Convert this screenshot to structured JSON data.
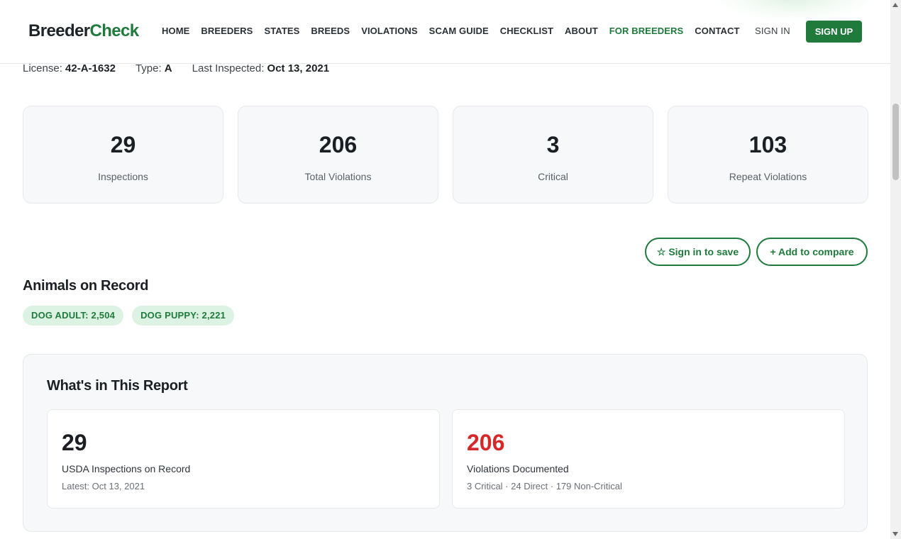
{
  "brand": {
    "part1": "Breeder",
    "part2": "Check",
    "accent_color": "#1f7a3c"
  },
  "nav": {
    "items": [
      {
        "label": "HOME"
      },
      {
        "label": "BREEDERS"
      },
      {
        "label": "STATES"
      },
      {
        "label": "BREEDS"
      },
      {
        "label": "VIOLATIONS"
      },
      {
        "label": "SCAM GUIDE"
      },
      {
        "label": "CHECKLIST"
      },
      {
        "label": "ABOUT"
      },
      {
        "label": "FOR BREEDERS",
        "highlight": true
      },
      {
        "label": "CONTACT"
      }
    ],
    "sign_in": "SIGN IN",
    "sign_up": "SIGN UP"
  },
  "meta": {
    "license_label": "License:",
    "license_value": "42-A-1632",
    "type_label": "Type:",
    "type_value": "A",
    "inspected_label": "Last Inspected:",
    "inspected_value": "Oct 13, 2021"
  },
  "stats": [
    {
      "value": "29",
      "label": "Inspections"
    },
    {
      "value": "206",
      "label": "Total Violations"
    },
    {
      "value": "3",
      "label": "Critical"
    },
    {
      "value": "103",
      "label": "Repeat Violations"
    }
  ],
  "actions": {
    "save": "☆ Sign in to save",
    "compare": "+ Add to compare"
  },
  "animals": {
    "title": "Animals on Record",
    "pills": [
      "DOG ADULT: 2,504",
      "DOG PUPPY: 2,221"
    ]
  },
  "report": {
    "title": "What's in This Report",
    "inspections": {
      "value": "29",
      "label": "USDA Inspections on Record",
      "sub": "Latest: Oct 13, 2021"
    },
    "violations": {
      "value": "206",
      "label": "Violations Documented",
      "sub": "3 Critical · 24 Direct · 179 Non-Critical",
      "value_color": "#d62828"
    }
  }
}
